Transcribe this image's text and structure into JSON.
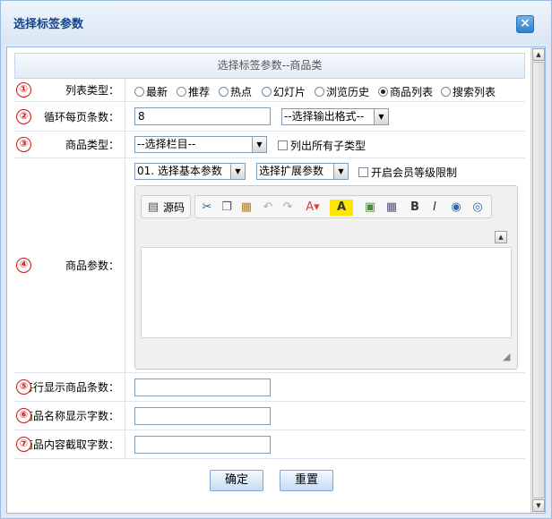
{
  "window": {
    "title": "选择标签参数",
    "close": "×"
  },
  "form": {
    "header": "选择标签参数--商品类",
    "rows": {
      "list_type": {
        "badge": "①",
        "label": "列表类型：",
        "options": [
          "最新",
          "推荐",
          "热点",
          "幻灯片",
          "浏览历史",
          "商品列表",
          "搜索列表"
        ],
        "selected": "商品列表"
      },
      "per_page": {
        "badge": "②",
        "label": "循环每页条数：",
        "value": "8",
        "format_select": "--选择输出格式--"
      },
      "category": {
        "badge": "③",
        "label": "商品类型：",
        "select": "--选择栏目--",
        "checkbox_label": "列出所有子类型"
      },
      "params": {
        "badge": "④",
        "label": "商品参数：",
        "basic_select": "01. 选择基本参数",
        "ext_select": "选择扩展参数",
        "checkbox_label": "开启会员等级限制",
        "source_label": "源码"
      },
      "per_row": {
        "badge": "⑤",
        "label": "每行显示商品条数："
      },
      "name_len": {
        "badge": "⑥",
        "label": "商品名称显示字数："
      },
      "content_len": {
        "badge": "⑦",
        "label": "商品内容截取字数："
      }
    },
    "buttons": {
      "ok": "确定",
      "reset": "重置"
    }
  },
  "icons": {
    "toolbar": [
      "source-icon",
      "cut-icon",
      "copy-icon",
      "paste-icon",
      "undo-icon",
      "redo-icon",
      "font-color-icon",
      "bg-color-icon",
      "image-icon",
      "table-icon",
      "bold-icon",
      "italic-icon",
      "link-icon",
      "unlink-icon"
    ]
  },
  "colors": {
    "title": "#15428b",
    "badge": "#d21010",
    "border": "#99bbe8"
  }
}
